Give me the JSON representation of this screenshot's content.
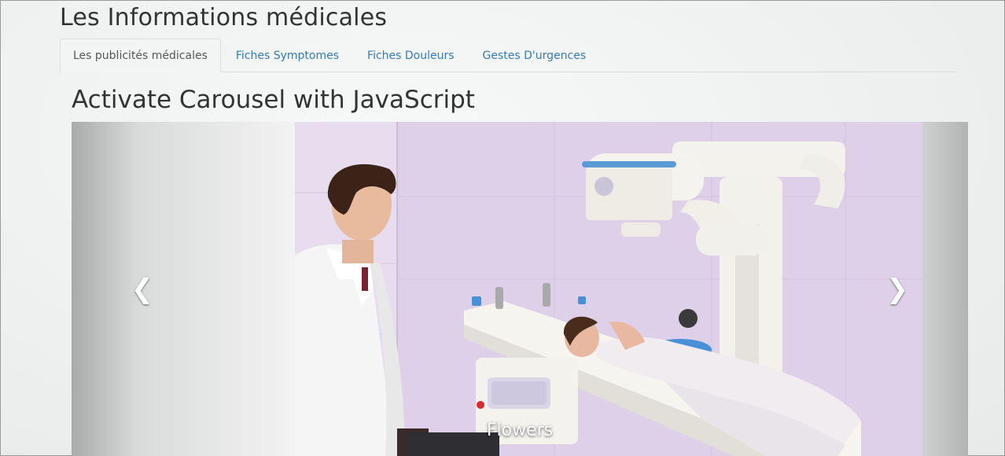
{
  "header": {
    "title": "Les Informations médicales"
  },
  "tabs": [
    {
      "label": "Les publicités médicales",
      "active": true
    },
    {
      "label": "Fiches Symptomes",
      "active": false
    },
    {
      "label": "Fiches Douleurs",
      "active": false
    },
    {
      "label": "Gestes D'urgences",
      "active": false
    }
  ],
  "main": {
    "heading": "Activate Carousel with JavaScript",
    "carousel": {
      "slide_image": "x-ray-exam-photo",
      "caption_title": "Flowers",
      "prev_icon": "chevron-left-icon",
      "next_icon": "chevron-right-icon"
    }
  },
  "colors": {
    "link": "#337ab7",
    "text": "#333333",
    "tab_border": "#dddddd"
  }
}
